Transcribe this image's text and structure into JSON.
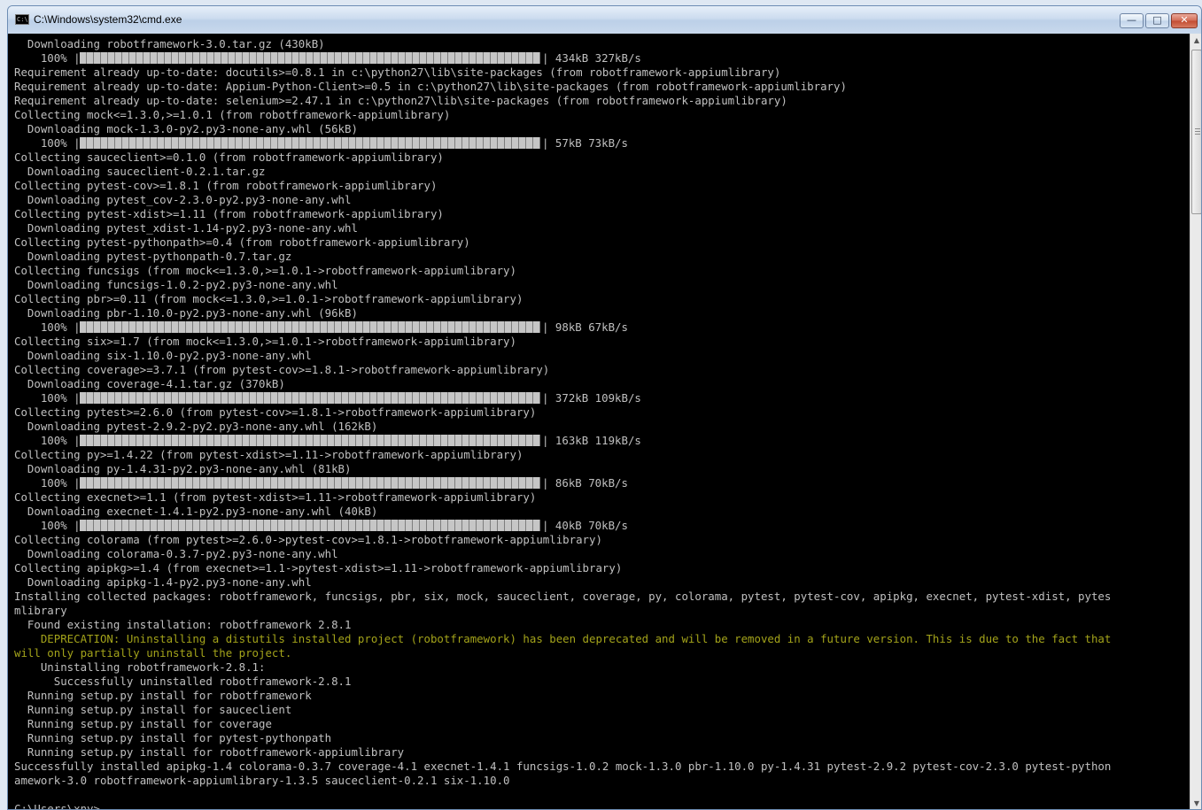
{
  "window": {
    "title": "C:\\Windows\\system32\\cmd.exe",
    "icon_text": "C:\\",
    "controls": {
      "minimize": "—",
      "maximize": "□",
      "close": "✕"
    }
  },
  "console": {
    "lines": [
      "  Downloading robotframework-3.0.tar.gz (430kB)",
      "    100% |",
      "Requirement already up-to-date: docutils>=0.8.1 in c:\\python27\\lib\\site-packages (from robotframework-appiumlibrary)",
      "Requirement already up-to-date: Appium-Python-Client>=0.5 in c:\\python27\\lib\\site-packages (from robotframework-appiumlibrary)",
      "Requirement already up-to-date: selenium>=2.47.1 in c:\\python27\\lib\\site-packages (from robotframework-appiumlibrary)",
      "Collecting mock<=1.3.0,>=1.0.1 (from robotframework-appiumlibrary)",
      "  Downloading mock-1.3.0-py2.py3-none-any.whl (56kB)",
      "    100% |",
      "Collecting sauceclient>=0.1.0 (from robotframework-appiumlibrary)",
      "  Downloading sauceclient-0.2.1.tar.gz",
      "Collecting pytest-cov>=1.8.1 (from robotframework-appiumlibrary)",
      "  Downloading pytest_cov-2.3.0-py2.py3-none-any.whl",
      "Collecting pytest-xdist>=1.11 (from robotframework-appiumlibrary)",
      "  Downloading pytest_xdist-1.14-py2.py3-none-any.whl",
      "Collecting pytest-pythonpath>=0.4 (from robotframework-appiumlibrary)",
      "  Downloading pytest-pythonpath-0.7.tar.gz",
      "Collecting funcsigs (from mock<=1.3.0,>=1.0.1->robotframework-appiumlibrary)",
      "  Downloading funcsigs-1.0.2-py2.py3-none-any.whl",
      "Collecting pbr>=0.11 (from mock<=1.3.0,>=1.0.1->robotframework-appiumlibrary)",
      "  Downloading pbr-1.10.0-py2.py3-none-any.whl (96kB)",
      "    100% |",
      "Collecting six>=1.7 (from mock<=1.3.0,>=1.0.1->robotframework-appiumlibrary)",
      "  Downloading six-1.10.0-py2.py3-none-any.whl",
      "Collecting coverage>=3.7.1 (from pytest-cov>=1.8.1->robotframework-appiumlibrary)",
      "  Downloading coverage-4.1.tar.gz (370kB)",
      "    100% |",
      "Collecting pytest>=2.6.0 (from pytest-cov>=1.8.1->robotframework-appiumlibrary)",
      "  Downloading pytest-2.9.2-py2.py3-none-any.whl (162kB)",
      "    100% |",
      "Collecting py>=1.4.22 (from pytest-xdist>=1.11->robotframework-appiumlibrary)",
      "  Downloading py-1.4.31-py2.py3-none-any.whl (81kB)",
      "    100% |",
      "Collecting execnet>=1.1 (from pytest-xdist>=1.11->robotframework-appiumlibrary)",
      "  Downloading execnet-1.4.1-py2.py3-none-any.whl (40kB)",
      "    100% |",
      "Collecting colorama (from pytest>=2.6.0->pytest-cov>=1.8.1->robotframework-appiumlibrary)",
      "  Downloading colorama-0.3.7-py2.py3-none-any.whl",
      "Collecting apipkg>=1.4 (from execnet>=1.1->pytest-xdist>=1.11->robotframework-appiumlibrary)",
      "  Downloading apipkg-1.4-py2.py3-none-any.whl",
      "Installing collected packages: robotframework, funcsigs, pbr, six, mock, sauceclient, coverage, py, colorama, pytest, pytest-cov, apipkg, execnet, pytest-xdist, pytes",
      "mlibrary",
      "  Found existing installation: robotframework 2.8.1",
      "    DEPRECATION: Uninstalling a distutils installed project (robotframework) has been deprecated and will be removed in a future version. This is due to the fact that",
      "will only partially uninstall the project.",
      "    Uninstalling robotframework-2.8.1:",
      "      Successfully uninstalled robotframework-2.8.1",
      "  Running setup.py install for robotframework",
      "  Running setup.py install for sauceclient",
      "  Running setup.py install for coverage",
      "  Running setup.py install for pytest-pythonpath",
      "  Running setup.py install for robotframework-appiumlibrary",
      "Successfully installed apipkg-1.4 colorama-0.3.7 coverage-4.1 execnet-1.4.1 funcsigs-1.0.2 mock-1.3.0 pbr-1.10.0 py-1.4.31 pytest-2.9.2 pytest-cov-2.3.0 pytest-python",
      "amework-3.0 robotframework-appiumlibrary-1.3.5 sauceclient-0.2.1 six-1.10.0",
      "",
      "C:\\Users\\xny>"
    ],
    "warning_lines": [
      42,
      43
    ],
    "progress_lines": [
      1,
      7,
      20,
      25,
      28,
      31,
      34
    ],
    "progress_tails": [
      "| 434kB 327kB/s",
      "| 57kB 73kB/s",
      "| 98kB 67kB/s",
      "| 372kB 109kB/s",
      "| 163kB 119kB/s",
      "| 86kB 70kB/s",
      "| 40kB 70kB/s"
    ],
    "progress_fraction": 1.0,
    "colors": {
      "background": "#000000",
      "text": "#c0c0c0",
      "warning": "#a3a31a"
    }
  }
}
